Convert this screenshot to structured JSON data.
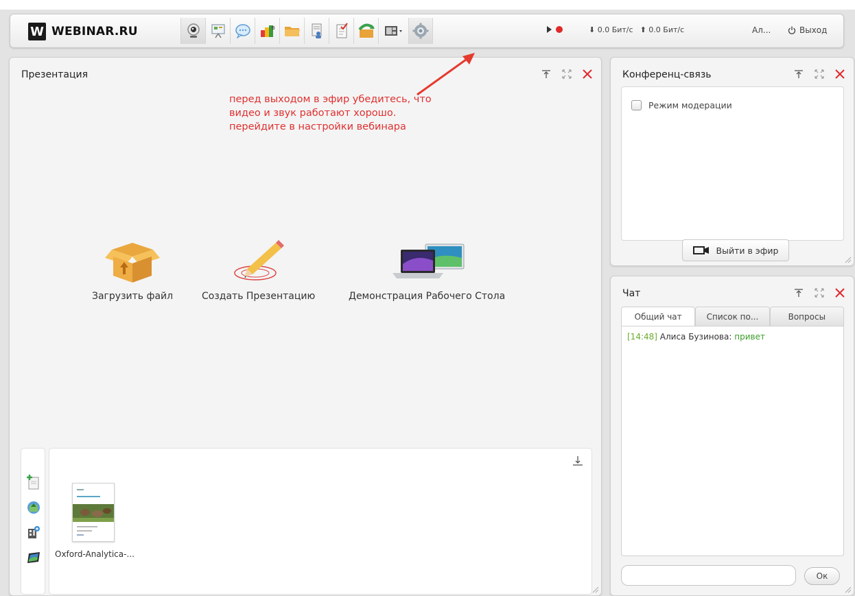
{
  "header": {
    "logo_letter": "W",
    "logo_text": "WEBINAR.RU",
    "tools": [
      {
        "name": "webcam-icon"
      },
      {
        "name": "presentation-icon"
      },
      {
        "name": "chat-bubble-icon"
      },
      {
        "name": "poll-icon"
      },
      {
        "name": "folder-icon"
      },
      {
        "name": "participants-icon"
      },
      {
        "name": "test-icon"
      },
      {
        "name": "export-icon"
      },
      {
        "name": "layout-icon"
      },
      {
        "name": "gear-icon"
      }
    ],
    "download_rate": "0.0 Бит/с",
    "upload_rate": "0.0 Бит/с",
    "user_short": "Ал...",
    "logout_label": "Выход"
  },
  "presentation": {
    "title": "Презентация",
    "hint_lines": [
      "перед выходом в эфир убедитесь, что",
      "видео и звук работают хорошо.",
      "перейдите в настройки вебинара"
    ],
    "actions": [
      {
        "label": "Загрузить файл",
        "icon": "box-upload-icon"
      },
      {
        "label": "Создать Презентацию",
        "icon": "pencil-draw-icon"
      },
      {
        "label": "Демонстрация Рабочего Стола",
        "icon": "laptop-screen-icon"
      }
    ],
    "file": {
      "name": "Oxford-Analytica-..."
    }
  },
  "conference": {
    "title": "Конференц-связь",
    "moderation_label": "Режим модерации",
    "go_live_label": "Выйти в эфир"
  },
  "chat": {
    "title": "Чат",
    "tabs": [
      "Общий чат",
      "Список по...",
      "Вопросы"
    ],
    "messages": [
      {
        "time": "[14:48]",
        "author": "Алиса Бузинова:",
        "text": "привет"
      }
    ],
    "send_label": "Ок"
  },
  "colors": {
    "hint_red": "#e03030",
    "close_red": "#e0282d",
    "chat_green": "#3b9d2a"
  }
}
